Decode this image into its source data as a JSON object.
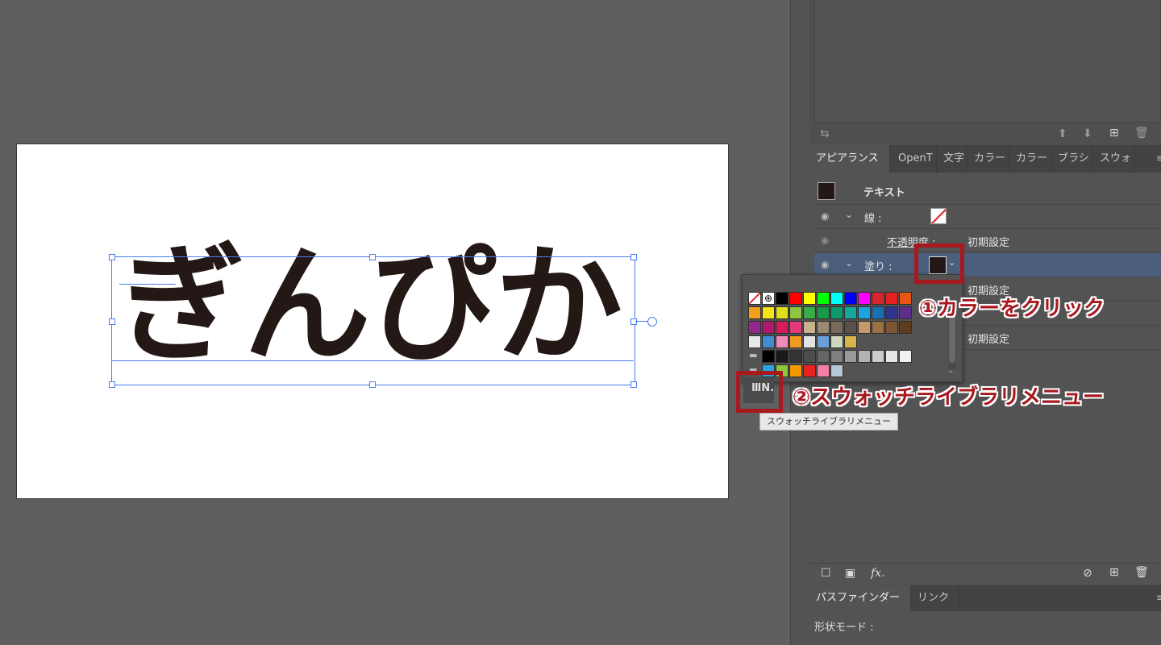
{
  "canvas": {
    "artwork_text": "ぎんぴか"
  },
  "appearance_panel": {
    "tabs": [
      "アピアランス",
      "OpenT",
      "文字",
      "カラー",
      "カラー",
      "ブラシ",
      "スウォ"
    ],
    "object_type": "テキスト",
    "stroke_label": "線 :",
    "opacity_label": "不透明度 :",
    "opacity_value": "初期設定",
    "fill_label": "塗り :",
    "fill_opacity_value": "初期設定",
    "opacity_value_2": "初期設定",
    "fx_label": "fx."
  },
  "pathfinder_panel": {
    "tabs": [
      "パスファインダー",
      "リンク"
    ],
    "shape_mode_label": "形状モード :"
  },
  "swatch_popup": {
    "rows": [
      [
        "#ffffff",
        "#ffffff",
        "#000000",
        "#ff0000",
        "#ffff00",
        "#00ff00",
        "#00ffff",
        "#0000ff",
        "#ff00ff",
        "#d7262e",
        "#e6201f",
        "#e95514"
      ],
      [
        "#f2a01e",
        "#f7e416",
        "#dede1b",
        "#8ec63f",
        "#3aab49",
        "#199948",
        "#0e9a6d",
        "#14a99b",
        "#1ba4dd",
        "#1a6fb5",
        "#2d3590",
        "#5d2d8b"
      ],
      [
        "#91298c",
        "#b0176c",
        "#d91a5b",
        "#e5397b",
        "#c9b28e",
        "#9b8a6f",
        "#786b59",
        "#5c5149",
        "#c49a6c",
        "#9b7042",
        "#7d5631",
        "#5e3c1e"
      ],
      [
        "#e8e8e8",
        "#3f8fd0",
        "#ef8bb6",
        "#f29b20",
        "#e2e2e2",
        "#6aa0d8",
        "#cfd7bf",
        "#d6b64a"
      ],
      [
        "#000000",
        "#1a1a1a",
        "#333333",
        "#4d4d4d",
        "#666666",
        "#808080",
        "#999999",
        "#b3b3b3",
        "#cccccc",
        "#e6e6e6",
        "#f2f2f2"
      ],
      [
        "#2aa4e0",
        "#8cc63e",
        "#f39800",
        "#e8221e",
        "#f37fa6",
        "#b5c8d8"
      ]
    ],
    "library_menu_tooltip": "スウォッチライブラリメニュー"
  },
  "annotations": {
    "step1": "①カラーをクリック",
    "step2": "②スウォッチライブラリメニュー"
  },
  "colors": {
    "fill_color": "#231815",
    "annotation_red": "#a8191f",
    "selection_blue": "#4a7cf0"
  }
}
